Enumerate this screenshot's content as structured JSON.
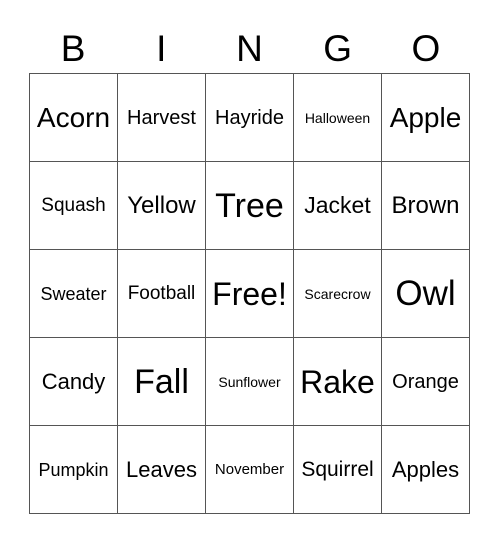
{
  "header": {
    "letters": [
      "B",
      "I",
      "N",
      "G",
      "O"
    ]
  },
  "board": {
    "rows": [
      [
        "Acorn",
        "Harvest",
        "Hayride",
        "Halloween",
        "Apple"
      ],
      [
        "Squash",
        "Yellow",
        "Tree",
        "Jacket",
        "Brown"
      ],
      [
        "Sweater",
        "Football",
        "Free!",
        "Scarecrow",
        "Owl"
      ],
      [
        "Candy",
        "Fall",
        "Sunflower",
        "Rake",
        "Orange"
      ],
      [
        "Pumpkin",
        "Leaves",
        "November",
        "Squirrel",
        "Apples"
      ]
    ],
    "free_space": {
      "row": 2,
      "col": 2,
      "label": "Free!"
    }
  },
  "colors": {
    "background": "#ffffff",
    "text": "#000000",
    "grid_lines": "#555555"
  }
}
